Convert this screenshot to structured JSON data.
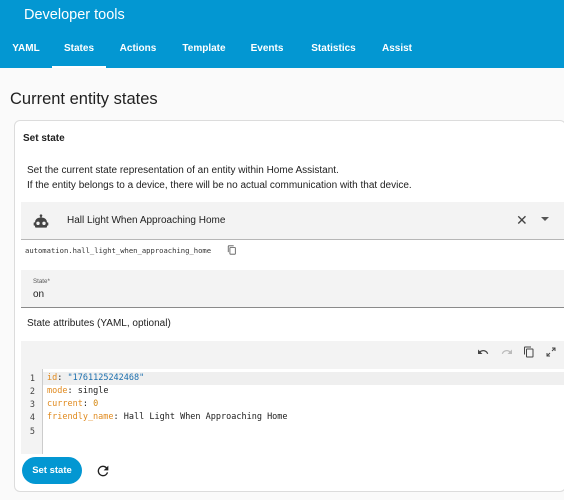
{
  "app": {
    "title": "Developer tools"
  },
  "tabs": [
    {
      "label": "YAML",
      "active": false
    },
    {
      "label": "States",
      "active": true
    },
    {
      "label": "Actions",
      "active": false
    },
    {
      "label": "Template",
      "active": false
    },
    {
      "label": "Events",
      "active": false
    },
    {
      "label": "Statistics",
      "active": false
    },
    {
      "label": "Assist",
      "active": false
    }
  ],
  "page": {
    "title": "Current entity states"
  },
  "set_state_card": {
    "title": "Set state",
    "description_line1": "Set the current state representation of an entity within Home Assistant.",
    "description_line2": "If the entity belongs to a device, there will be no actual communication with that device.",
    "entity_picker": {
      "entity_name": "Hall Light When Approaching Home",
      "icon": "robot-icon",
      "clear_glyph": "✕"
    },
    "entity_id": "automation.hall_light_when_approaching_home",
    "state_field": {
      "label": "State*",
      "value": "on"
    },
    "attributes_label": "State attributes (YAML, optional)",
    "editor": {
      "toolbar_icons": [
        "undo-icon",
        "redo-icon",
        "copy-icon",
        "fullscreen-icon"
      ],
      "lines": [
        {
          "number": "1",
          "key": "id",
          "value": "\"1761125242468\"",
          "value_type": "string"
        },
        {
          "number": "2",
          "key": "mode",
          "value": "single",
          "value_type": "plain"
        },
        {
          "number": "3",
          "key": "current",
          "value": "0",
          "value_type": "number"
        },
        {
          "number": "4",
          "key": "friendly_name",
          "value": "Hall Light When Approaching Home",
          "value_type": "plain"
        },
        {
          "number": "5",
          "key": "",
          "value": "",
          "value_type": "plain"
        }
      ]
    },
    "set_state_button": "Set state"
  },
  "colors": {
    "header": "#0397d2",
    "primary": "#0397d2",
    "yaml_key": "#e08a1e",
    "yaml_string": "#1c6fae"
  }
}
